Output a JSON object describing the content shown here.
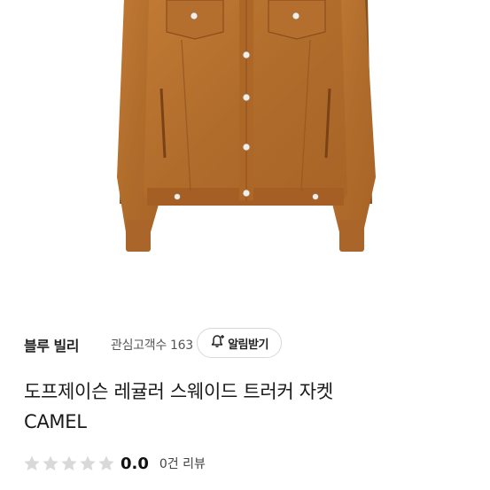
{
  "seller": {
    "name": "블루 빌리",
    "follower_text": "관심고객수 163",
    "alarm_label": "알림받기"
  },
  "product": {
    "title_line1": "도프제이슨 레귤러 스웨이드 트러커 자켓",
    "title_line2": "CAMEL"
  },
  "rating": {
    "score": "0.0",
    "stars_filled": 0,
    "stars_total": 5,
    "review_count": "0건 리뷰"
  },
  "colors": {
    "jacket": "#b8722e",
    "star_empty": "#d9d9d9"
  },
  "icons": [
    "bell-plus-icon",
    "star-icon"
  ]
}
